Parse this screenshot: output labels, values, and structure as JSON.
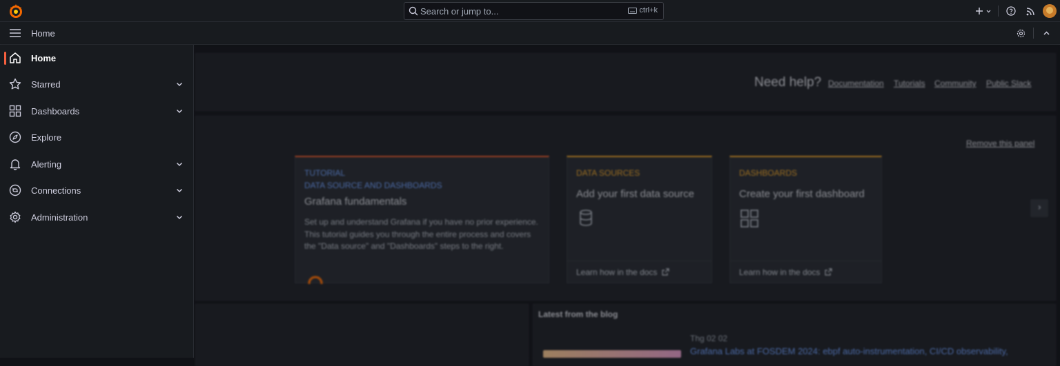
{
  "topbar": {
    "search_placeholder": "Search or jump to...",
    "search_shortcut": "ctrl+k"
  },
  "breadcrumb": {
    "current": "Home"
  },
  "sidebar": {
    "items": [
      {
        "label": "Home",
        "icon": "home-icon",
        "active": true,
        "expandable": false
      },
      {
        "label": "Starred",
        "icon": "star-icon",
        "active": false,
        "expandable": true
      },
      {
        "label": "Dashboards",
        "icon": "apps-icon",
        "active": false,
        "expandable": true
      },
      {
        "label": "Explore",
        "icon": "compass-icon",
        "active": false,
        "expandable": false
      },
      {
        "label": "Alerting",
        "icon": "bell-icon",
        "active": false,
        "expandable": true
      },
      {
        "label": "Connections",
        "icon": "connections-icon",
        "active": false,
        "expandable": true
      },
      {
        "label": "Administration",
        "icon": "cog-icon",
        "active": false,
        "expandable": true
      }
    ]
  },
  "help": {
    "title": "Need help?",
    "links": [
      "Documentation",
      "Tutorials",
      "Community",
      "Public Slack"
    ]
  },
  "getting_started": {
    "remove_label": "Remove this panel",
    "cards": [
      {
        "tag1": "TUTORIAL",
        "tag2": "DATA SOURCE AND DASHBOARDS",
        "title": "Grafana fundamentals",
        "description": "Set up and understand Grafana if you have no prior experience. This tutorial guides you through the entire process and covers the \"Data source\" and \"Dashboards\" steps to the right."
      },
      {
        "tag": "DATA SOURCES",
        "title": "Add your first data source",
        "footer": "Learn how in the docs"
      },
      {
        "tag": "DASHBOARDS",
        "title": "Create your first dashboard",
        "footer": "Learn how in the docs"
      }
    ]
  },
  "blog": {
    "heading": "Latest from the blog",
    "date": "Thg 02 02",
    "title": "Grafana Labs at FOSDEM 2024: ebpf auto-instrumentation, CI/CD observability,"
  },
  "colors": {
    "accent_active": "#f55f3e",
    "tutorial_tag": "#6e9fff",
    "datasource_tag": "#f5a623",
    "link_blue": "#6e9fff"
  }
}
